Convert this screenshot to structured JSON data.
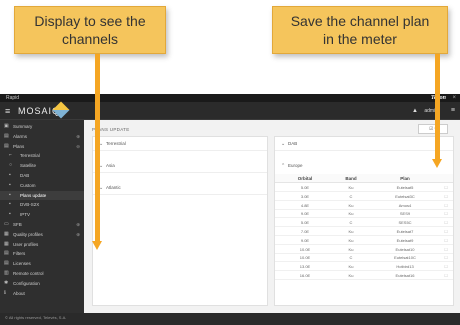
{
  "callouts": {
    "left": "Display to see the\nchannels",
    "right": "Save the channel plan\nin the meter"
  },
  "titlebar": {
    "text": "Rapid",
    "brand": "Tekon",
    "close": "×"
  },
  "header": {
    "logo": "MOSAIQ",
    "user": "admin",
    "user_icon": "▲",
    "menu_icon": "≡",
    "hamburger": "≡"
  },
  "sidebar": {
    "items": [
      {
        "icon": "▣",
        "label": "Summary",
        "expand": ""
      },
      {
        "icon": "▤",
        "label": "Alarms",
        "expand": "⊕"
      },
      {
        "icon": "▤",
        "label": "Plans",
        "expand": "⊖"
      },
      {
        "icon": "⌐",
        "label": "Terrestrial",
        "expand": "",
        "sub": true
      },
      {
        "icon": "○",
        "label": "Satellite",
        "expand": "",
        "sub": true
      },
      {
        "icon": "▪",
        "label": "DAB",
        "expand": "",
        "sub": true
      },
      {
        "icon": "▪",
        "label": "Custom",
        "expand": "",
        "sub": true
      },
      {
        "icon": "▪",
        "label": "Plans update",
        "expand": "",
        "sub": true,
        "active": true
      },
      {
        "icon": "▪",
        "label": "DVB-S2X",
        "expand": "",
        "sub": true
      },
      {
        "icon": "▪",
        "label": "IPTV",
        "expand": "",
        "sub": true
      },
      {
        "icon": "▭",
        "label": "SFB",
        "expand": "⊕"
      },
      {
        "icon": "▦",
        "label": "Quality profiles",
        "expand": "⊕"
      },
      {
        "icon": "▦",
        "label": "User profiles",
        "expand": ""
      },
      {
        "icon": "▤",
        "label": "Filters",
        "expand": ""
      },
      {
        "icon": "▤",
        "label": "Licenses",
        "expand": ""
      },
      {
        "icon": "▥",
        "label": "Remote control",
        "expand": ""
      },
      {
        "icon": "✱",
        "label": "Configuration",
        "expand": ""
      },
      {
        "icon": "ℹ",
        "label": "About",
        "expand": ""
      }
    ]
  },
  "content": {
    "title": "PLANS UPDATE",
    "title_button": "☑ ▾",
    "left_regions": [
      {
        "chev": "⌄",
        "name": "Terrestrial"
      },
      {
        "chev": "⌄",
        "name": "Asia"
      },
      {
        "chev": "⌄",
        "name": "Atlantic"
      }
    ],
    "right_regions": [
      {
        "chev": "⌄",
        "name": "DAB"
      },
      {
        "chev": "⌃",
        "name": "Europe"
      }
    ],
    "table": {
      "headers": [
        "Orbital",
        "Band",
        "Plan",
        ""
      ],
      "rows": [
        [
          "5.0E",
          "Ku",
          "Eutelsat5",
          "☐"
        ],
        [
          "3.0E",
          "C",
          "Eutelsat3C",
          "☐"
        ],
        [
          "4.8E",
          "Ku",
          "Amos4",
          "☐"
        ],
        [
          "9.0E",
          "Ku",
          "SES9",
          "☐"
        ],
        [
          "5.0E",
          "C",
          "SES5C",
          "☐"
        ],
        [
          "7.0E",
          "Ku",
          "Eutelsat7",
          "☐"
        ],
        [
          "9.0E",
          "Ku",
          "Eutelsat9",
          "☐"
        ],
        [
          "10.0E",
          "Ku",
          "Eutelsat10",
          "☐"
        ],
        [
          "10.0E",
          "C",
          "Eutelsat10C",
          "☐"
        ],
        [
          "13.0E",
          "Ku",
          "Hotbird13",
          "☐"
        ],
        [
          "16.0E",
          "Ku",
          "Eutelsat16",
          "☐"
        ]
      ]
    }
  },
  "footer": {
    "text": "© All rights reserved, Televés, S.A."
  },
  "colors": {
    "callout": "#f5c55c",
    "arrow": "#f5a623",
    "sidebar": "#2f2f2f"
  }
}
